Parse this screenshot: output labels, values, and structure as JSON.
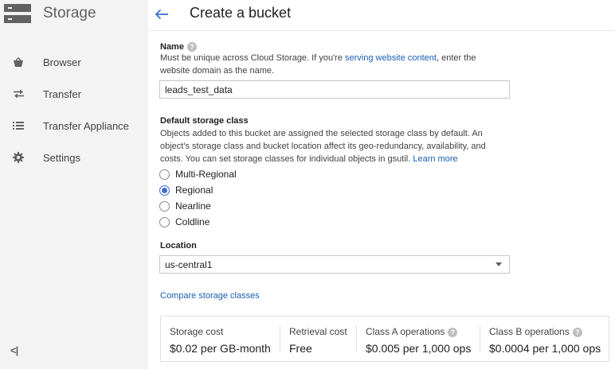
{
  "sidebar": {
    "brand": "Storage",
    "items": [
      {
        "label": "Browser",
        "icon": "basket-icon"
      },
      {
        "label": "Transfer",
        "icon": "transfer-arrows-icon"
      },
      {
        "label": "Transfer Appliance",
        "icon": "list-icon"
      },
      {
        "label": "Settings",
        "icon": "gear-icon"
      }
    ],
    "collapse_label": "<|"
  },
  "header": {
    "title": "Create a bucket"
  },
  "name_section": {
    "label": "Name",
    "desc_before": "Must be unique across Cloud Storage. If you're ",
    "desc_link": "serving website content",
    "desc_after": ", enter the website domain as the name.",
    "value": "leads_test_data"
  },
  "storage_class": {
    "label": "Default storage class",
    "desc": "Objects added to this bucket are assigned the selected storage class by default. An object's storage class and bucket location affect its geo-redundancy, availability, and costs. You can set storage classes for individual objects in gsutil. ",
    "learn_more": "Learn more",
    "options": [
      {
        "label": "Multi-Regional",
        "checked": false
      },
      {
        "label": "Regional",
        "checked": true
      },
      {
        "label": "Nearline",
        "checked": false
      },
      {
        "label": "Coldline",
        "checked": false
      }
    ]
  },
  "location": {
    "label": "Location",
    "value": "us-central1"
  },
  "compare_link": "Compare storage classes",
  "costs": [
    {
      "header": "Storage cost",
      "value": "$0.02 per GB-month",
      "help": false
    },
    {
      "header": "Retrieval cost",
      "value": "Free",
      "help": false
    },
    {
      "header": "Class A operations",
      "value": "$0.005 per 1,000 ops",
      "help": true
    },
    {
      "header": "Class B operations",
      "value": "$0.0004 per 1,000 ops",
      "help": true
    }
  ],
  "colors": {
    "accent": "#3b6fd8",
    "link": "#1a5fb4",
    "sidebar_bg": "#f3f3f3"
  }
}
